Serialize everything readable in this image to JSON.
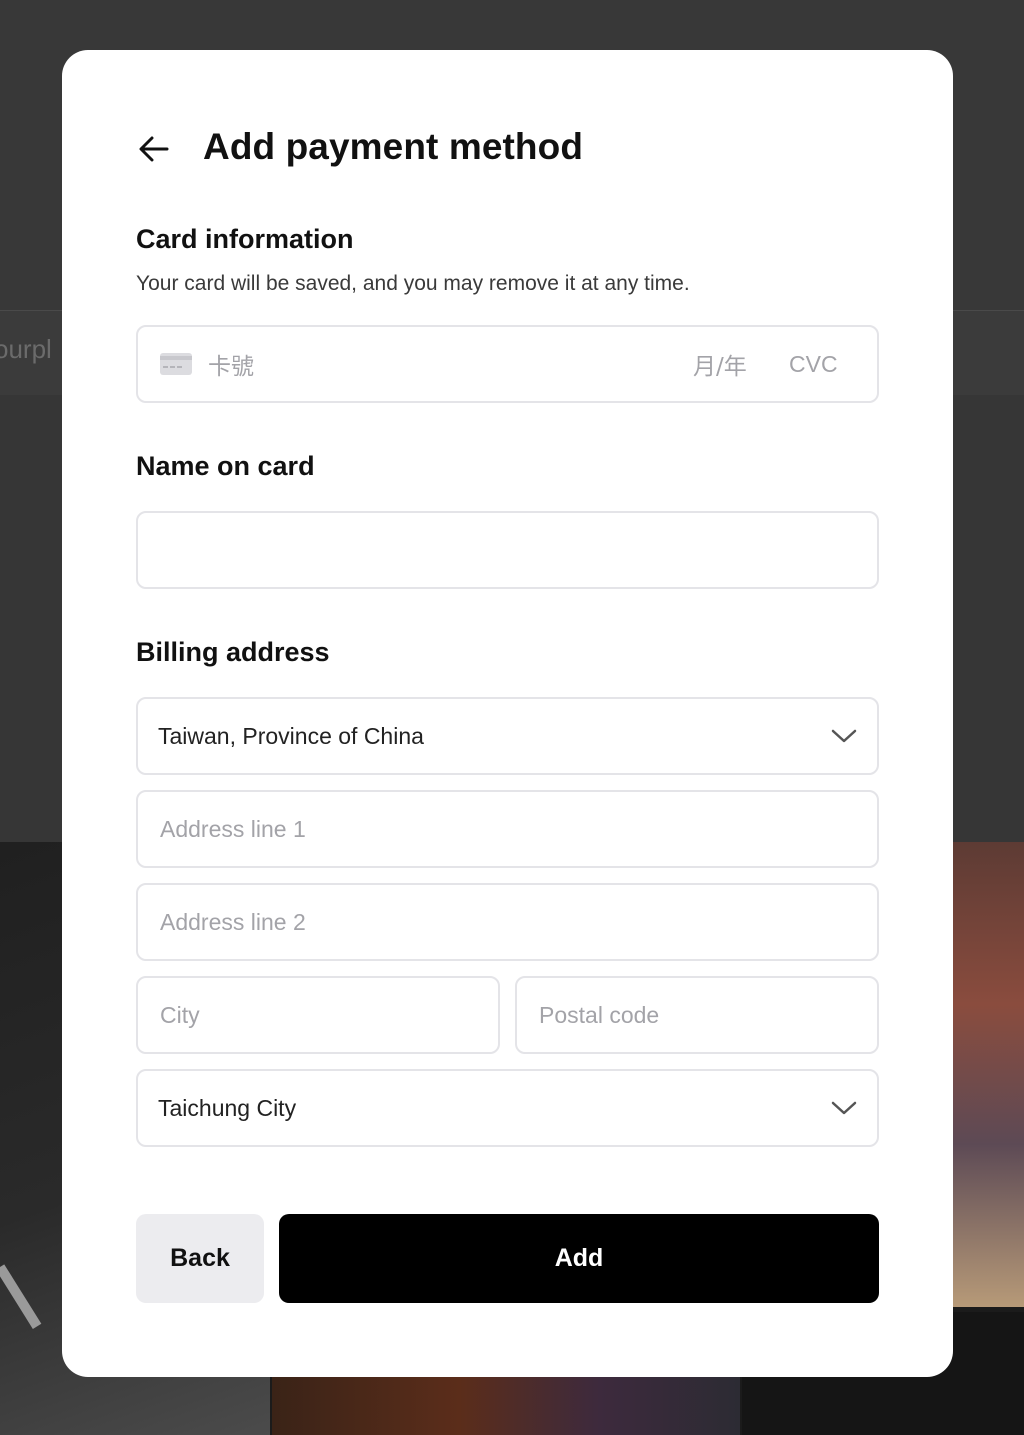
{
  "background": {
    "nav_fragment": "ourpl"
  },
  "modal": {
    "title": "Add payment method",
    "back_icon": "arrow-left-icon"
  },
  "card_info": {
    "label": "Card information",
    "description": "Your card will be saved, and you may remove it at any time.",
    "card_icon": "credit-card-icon",
    "number_placeholder": "卡號",
    "expiry_placeholder": "月/年",
    "cvc_placeholder": "CVC"
  },
  "name_on_card": {
    "label": "Name on card",
    "value": ""
  },
  "billing": {
    "label": "Billing address",
    "country": "Taiwan, Province of China",
    "address1_placeholder": "Address line 1",
    "address2_placeholder": "Address line 2",
    "city_placeholder": "City",
    "postal_placeholder": "Postal code",
    "region": "Taichung City",
    "dropdown_icon": "chevron-down-icon"
  },
  "actions": {
    "back_label": "Back",
    "add_label": "Add"
  },
  "colors": {
    "primary_button": "#000000",
    "secondary_button": "#ececef",
    "field_border": "#e4e4e8",
    "placeholder": "#a3a3a8"
  }
}
